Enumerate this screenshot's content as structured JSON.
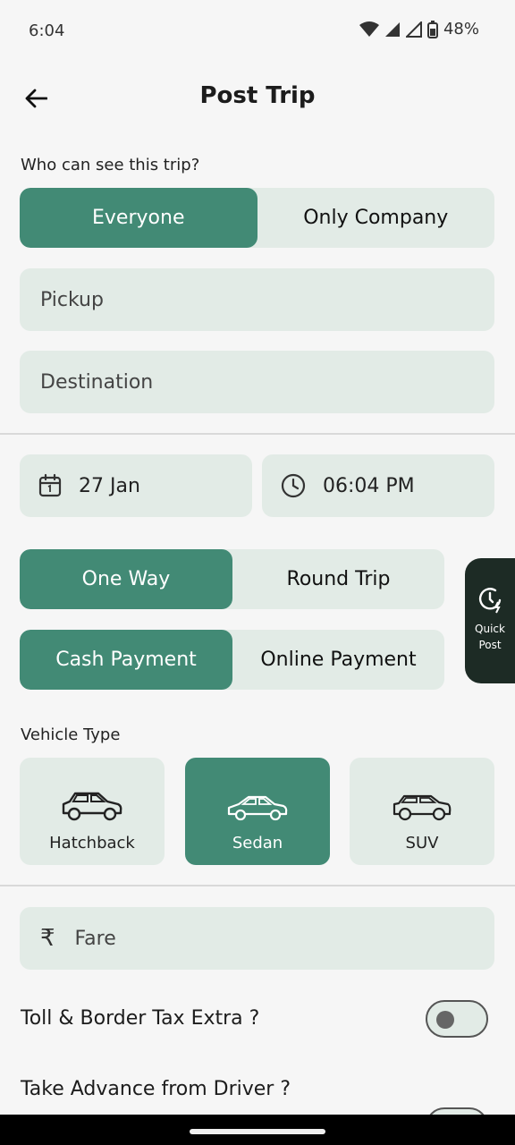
{
  "status": {
    "time": "6:04",
    "battery": "48%"
  },
  "header": {
    "title": "Post Trip"
  },
  "visibility": {
    "label": "Who can see this trip?",
    "options": [
      "Everyone",
      "Only Company"
    ],
    "selected": "Everyone"
  },
  "pickup": {
    "placeholder": "Pickup"
  },
  "destination": {
    "placeholder": "Destination"
  },
  "date": {
    "value": "27 Jan"
  },
  "time": {
    "value": "06:04 PM"
  },
  "trip_type": {
    "options": [
      "One Way",
      "Round Trip"
    ],
    "selected": "One Way"
  },
  "payment": {
    "options": [
      "Cash Payment",
      "Online Payment"
    ],
    "selected": "Cash Payment"
  },
  "vehicle": {
    "label": "Vehicle Type",
    "options": [
      "Hatchback",
      "Sedan",
      "SUV"
    ],
    "selected": "Sedan"
  },
  "fare": {
    "placeholder": "Fare",
    "currency_symbol": "₹"
  },
  "quick_post": {
    "line1": "Quick",
    "line2": "Post"
  },
  "toggles": [
    {
      "label": "Toll & Border Tax Extra ?",
      "on": false
    },
    {
      "label": "Take Advance from Driver ?",
      "on": false
    }
  ],
  "colors": {
    "accent": "#428a75",
    "field": "#e2ebe6",
    "dark": "#1d2b25"
  }
}
